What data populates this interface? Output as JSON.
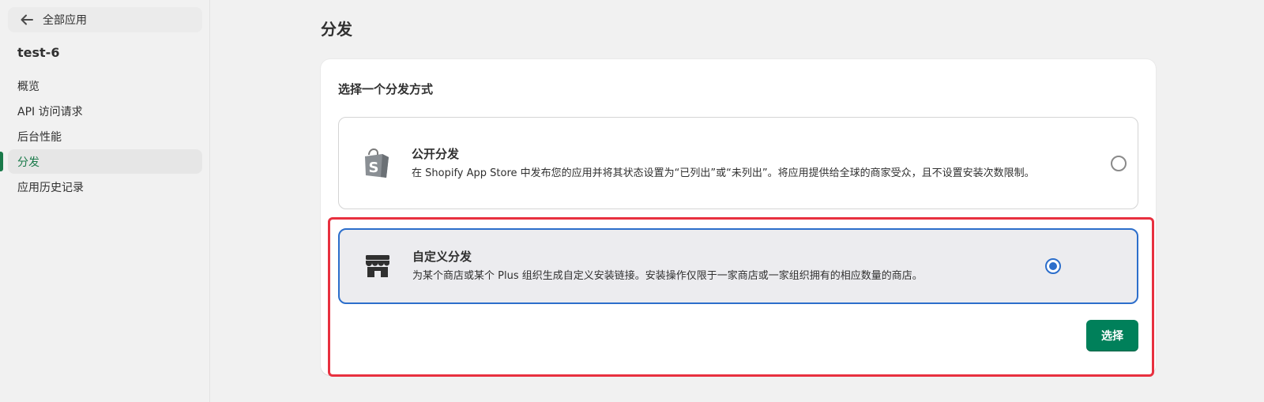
{
  "sidebar": {
    "back_label": "全部应用",
    "app_name": "test-6",
    "items": [
      {
        "label": "概览",
        "active": false
      },
      {
        "label": "API 访问请求",
        "active": false
      },
      {
        "label": "后台性能",
        "active": false
      },
      {
        "label": "分发",
        "active": true
      },
      {
        "label": "应用历史记录",
        "active": false
      }
    ]
  },
  "main": {
    "page_title": "分发",
    "card": {
      "heading": "选择一个分发方式",
      "options": [
        {
          "title": "公开分发",
          "description": "在 Shopify App Store 中发布您的应用并将其状态设置为“已列出”或“未列出”。将应用提供给全球的商家受众，且不设置安装次数限制。",
          "icon": "shopify-bag-icon",
          "selected": false
        },
        {
          "title": "自定义分发",
          "description": "为某个商店或某个 Plus 组织生成自定义安装链接。安装操作仅限于一家商店或一家组织拥有的相应数量的商店。",
          "icon": "store-icon",
          "selected": true
        }
      ],
      "select_button": "选择"
    }
  },
  "colors": {
    "accent_green": "#00805a",
    "selection_blue": "#2c6ecb",
    "highlight_red": "#e8303f"
  }
}
